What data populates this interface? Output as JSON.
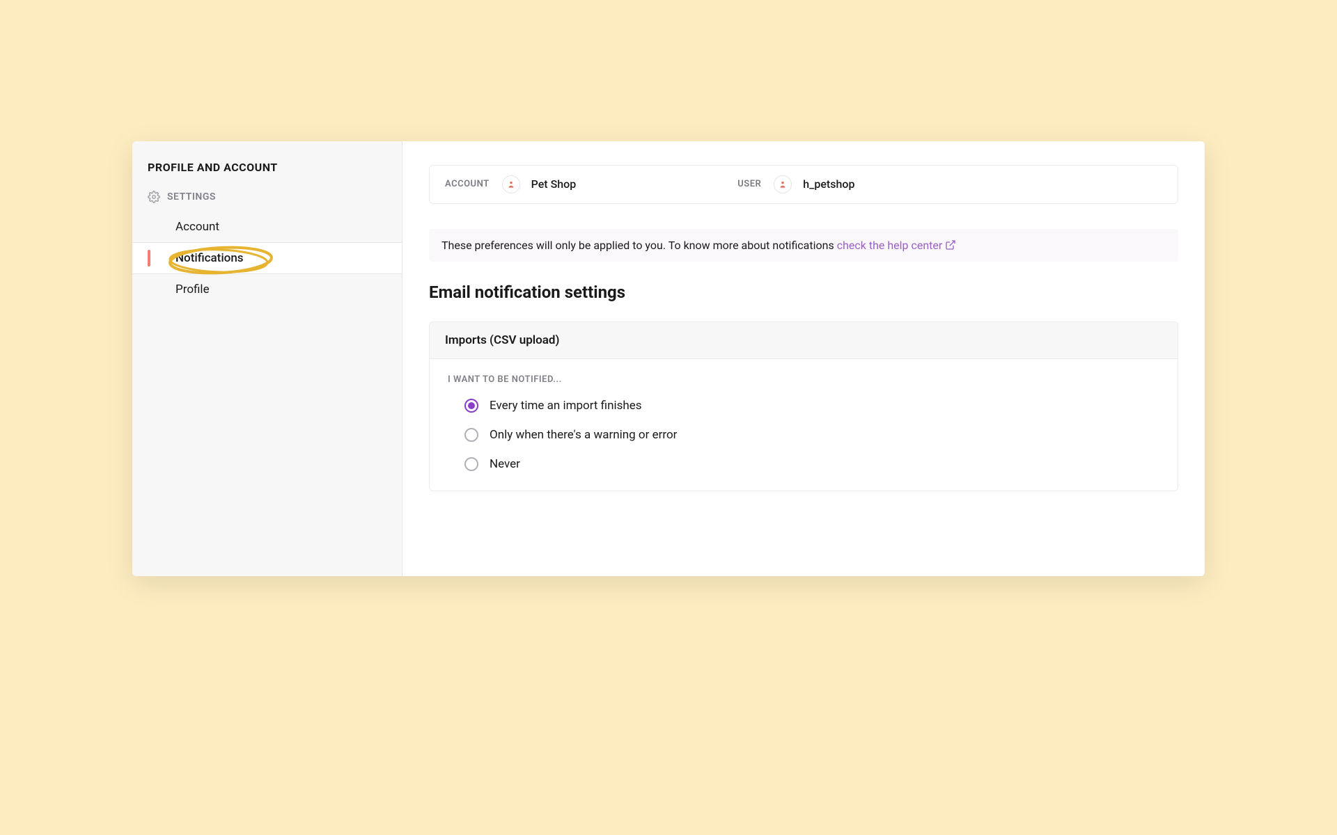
{
  "sidebar": {
    "title": "PROFILE AND ACCOUNT",
    "section_label": "SETTINGS",
    "items": [
      {
        "label": "Account"
      },
      {
        "label": "Notifications"
      },
      {
        "label": "Profile"
      }
    ]
  },
  "header": {
    "account_label": "ACCOUNT",
    "account_value": "Pet Shop",
    "user_label": "USER",
    "user_value": "h_petshop"
  },
  "notice": {
    "text": "These preferences will only be applied to you. To know more about notifications ",
    "link_text": "check the help center"
  },
  "main": {
    "heading": "Email notification settings",
    "card": {
      "title": "Imports (CSV upload)",
      "sublabel": "I WANT TO BE NOTIFIED...",
      "options": [
        {
          "label": "Every time an import finishes"
        },
        {
          "label": "Only when there's a warning or error"
        },
        {
          "label": "Never"
        }
      ],
      "selected_index": 0
    }
  }
}
